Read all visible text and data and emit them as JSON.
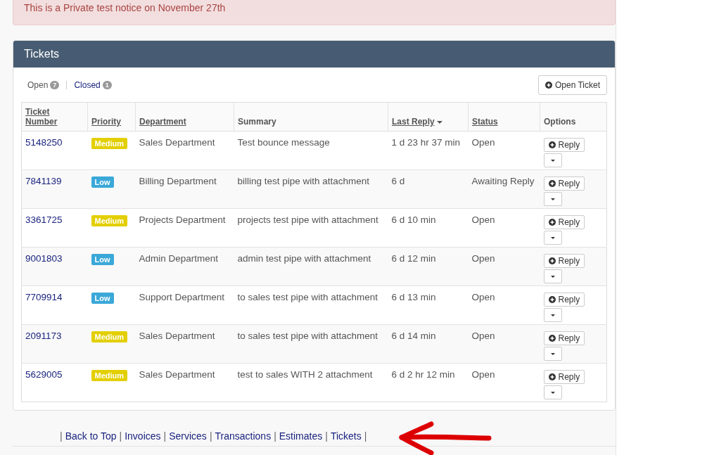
{
  "notice": {
    "text": "This is a Private test notice on November 27th"
  },
  "panel": {
    "title": "Tickets",
    "tabs": [
      {
        "label": "Open",
        "count": "7",
        "selected": true
      },
      {
        "label": "Closed",
        "count": "1",
        "selected": false
      }
    ],
    "open_ticket_button": "Open Ticket",
    "table": {
      "columns": [
        {
          "label": "Ticket Number",
          "sortable": true,
          "sorted": false
        },
        {
          "label": "Priority",
          "sortable": true,
          "sorted": false
        },
        {
          "label": "Department",
          "sortable": true,
          "sorted": false
        },
        {
          "label": "Summary",
          "sortable": false,
          "sorted": false
        },
        {
          "label": "Last Reply",
          "sortable": true,
          "sorted": true
        },
        {
          "label": "Status",
          "sortable": true,
          "sorted": false
        },
        {
          "label": "Options",
          "sortable": false,
          "sorted": false
        }
      ],
      "rows": [
        {
          "number": "5148250",
          "priority": {
            "label": "Medium",
            "color": "#e3cf00"
          },
          "department": "Sales Department",
          "summary": "Test bounce message",
          "last_reply": "1 d 23 hr 37 min",
          "status": "Open",
          "reply": "Reply"
        },
        {
          "number": "7841139",
          "priority": {
            "label": "Low",
            "color": "#3aa8d8"
          },
          "department": "Billing Department",
          "summary": "billing test pipe with attachment",
          "last_reply": "6 d",
          "status": "Awaiting Reply",
          "reply": "Reply"
        },
        {
          "number": "3361725",
          "priority": {
            "label": "Medium",
            "color": "#e3cf00"
          },
          "department": "Projects Department",
          "summary": "projects test pipe with attachment",
          "last_reply": "6 d 10 min",
          "status": "Open",
          "reply": "Reply"
        },
        {
          "number": "9001803",
          "priority": {
            "label": "Low",
            "color": "#3aa8d8"
          },
          "department": "Admin Department",
          "summary": "admin test pipe with attachment",
          "last_reply": "6 d 12 min",
          "status": "Open",
          "reply": "Reply"
        },
        {
          "number": "7709914",
          "priority": {
            "label": "Low",
            "color": "#3aa8d8"
          },
          "department": "Support Department",
          "summary": "to sales test pipe with attachment",
          "last_reply": "6 d 13 min",
          "status": "Open",
          "reply": "Reply"
        },
        {
          "number": "2091173",
          "priority": {
            "label": "Medium",
            "color": "#e3cf00"
          },
          "department": "Sales Department",
          "summary": "to sales test pipe with attachment",
          "last_reply": "6 d 14 min",
          "status": "Open",
          "reply": "Reply"
        },
        {
          "number": "5629005",
          "priority": {
            "label": "Medium",
            "color": "#e3cf00"
          },
          "department": "Sales Department",
          "summary": "test to sales WITH 2 attachment",
          "last_reply": "6 d 2 hr 12 min",
          "status": "Open",
          "reply": "Reply"
        }
      ]
    }
  },
  "footer": {
    "separator": "|",
    "links": [
      "Back to Top",
      "Invoices",
      "Services",
      "Transactions",
      "Estimates",
      "Tickets"
    ]
  }
}
